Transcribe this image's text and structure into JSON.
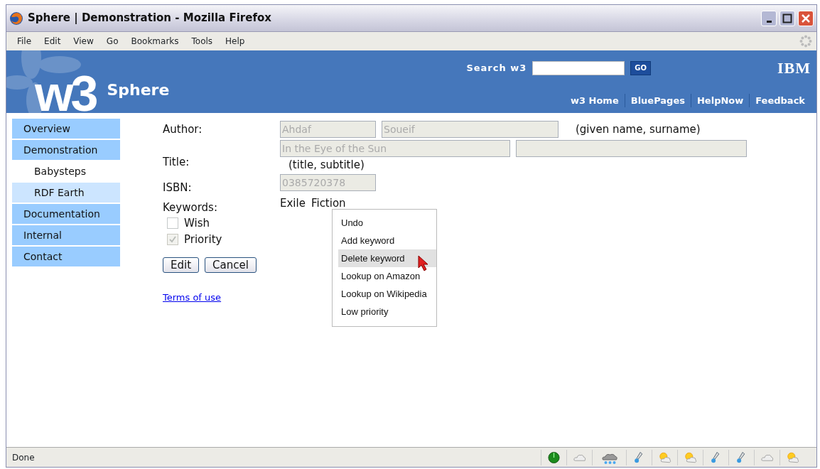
{
  "window": {
    "title": "Sphere | Demonstration - Mozilla Firefox"
  },
  "menu": [
    "File",
    "Edit",
    "View",
    "Go",
    "Bookmarks",
    "Tools",
    "Help"
  ],
  "banner": {
    "logo": "w3",
    "site": "Sphere",
    "search_label": "Search w3",
    "search_button": "GO",
    "brand": "IBM",
    "links": [
      "w3 Home",
      "BluePages",
      "HelpNow",
      "Feedback"
    ]
  },
  "sidebar": {
    "items": [
      {
        "label": "Overview",
        "selected": false
      },
      {
        "label": "Demonstration",
        "selected": false,
        "children": [
          {
            "label": "Babysteps",
            "selected": false
          },
          {
            "label": "RDF Earth",
            "selected": true
          }
        ]
      },
      {
        "label": "Documentation",
        "selected": false
      },
      {
        "label": "Internal",
        "selected": false
      },
      {
        "label": "Contact",
        "selected": false
      }
    ]
  },
  "form": {
    "author_label": "Author:",
    "given_name": "Ahdaf",
    "surname": "Soueif",
    "author_hint": "(given name, surname)",
    "title_label": "Title:",
    "title": "In the Eye of the Sun",
    "title_hint": "(title, subtitle)",
    "isbn_label": "ISBN:",
    "isbn": "0385720378",
    "keywords_label": "Keywords:",
    "keywords": [
      "Exile",
      "Fiction"
    ],
    "checks": [
      {
        "label": "Wish",
        "checked": false,
        "disabled": false
      },
      {
        "label": "Priority",
        "checked": true,
        "disabled": true
      }
    ],
    "buttons": [
      "Edit",
      "Cancel"
    ],
    "terms_link": "Terms of use"
  },
  "context_menu": [
    {
      "label": "Undo",
      "selected": false
    },
    {
      "label": "Add keyword",
      "selected": false
    },
    {
      "label": "Delete keyword",
      "selected": true
    },
    {
      "label": "Lookup on Amazon",
      "selected": false
    },
    {
      "label": "Lookup on Wikipedia",
      "selected": false
    },
    {
      "label": "Low priority",
      "selected": false
    }
  ],
  "status_bar": {
    "text": "Done"
  }
}
